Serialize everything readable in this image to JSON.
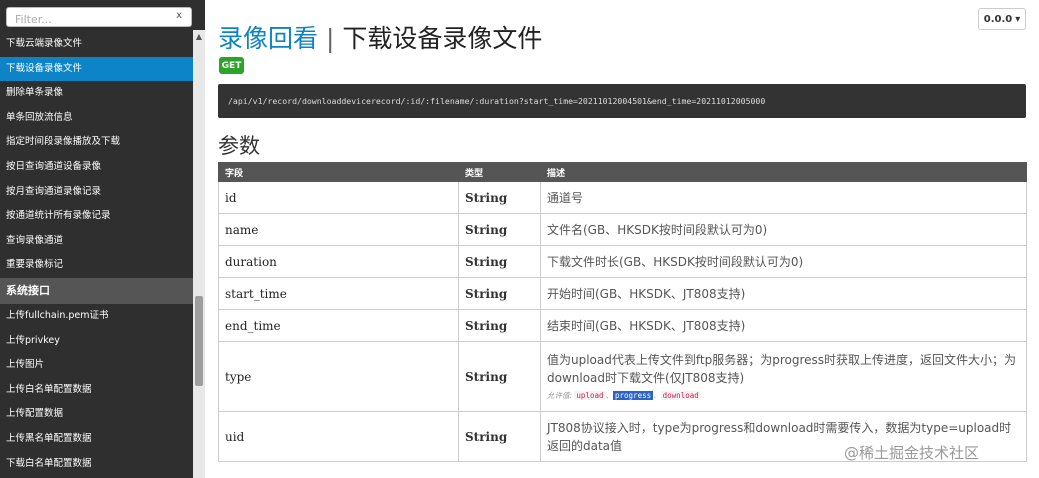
{
  "sidebar": {
    "filter_placeholder": "Filter...",
    "filter_clear": "x",
    "items": [
      {
        "label": "下载云端录像文件",
        "active": false
      },
      {
        "label": "下载设备录像文件",
        "active": true
      },
      {
        "label": "删除单条录像",
        "active": false
      },
      {
        "label": "单条回放流信息",
        "active": false
      },
      {
        "label": "指定时间段录像播放及下载",
        "active": false
      },
      {
        "label": "按日查询通道设备录像",
        "active": false
      },
      {
        "label": "按月查询通道录像记录",
        "active": false
      },
      {
        "label": "按通道统计所有录像记录",
        "active": false
      },
      {
        "label": "查询录像通道",
        "active": false
      },
      {
        "label": "重要录像标记",
        "active": false
      }
    ],
    "section_label": "系统接口",
    "items2": [
      {
        "label": "上传fullchain.pem证书"
      },
      {
        "label": "上传privkey"
      },
      {
        "label": "上传图片"
      },
      {
        "label": "上传白名单配置数据"
      },
      {
        "label": "上传配置数据"
      },
      {
        "label": "上传黑名单配置数据"
      },
      {
        "label": "下载白名单配置数据"
      }
    ]
  },
  "header": {
    "title_link": "录像回看",
    "title_sep": "|",
    "title_rest": "下载设备录像文件",
    "version": "0.0.0",
    "method": "GET",
    "url": "/api/v1/record/downloaddevicerecord/:id/:filename/:duration?start_time=20211012004501&end_time=20211012005000"
  },
  "params": {
    "heading": "参数",
    "columns": [
      "字段",
      "类型",
      "描述"
    ],
    "rows": [
      {
        "field": "id",
        "type": "String",
        "desc": "通道号"
      },
      {
        "field": "name",
        "type": "String",
        "desc": "文件名(GB、HKSDK按时间段默认可为0)"
      },
      {
        "field": "duration",
        "type": "String",
        "desc": "下载文件时长(GB、HKSDK按时间段默认可为0)"
      },
      {
        "field": "start_time",
        "type": "String",
        "desc": "开始时间(GB、HKSDK、JT808支持)"
      },
      {
        "field": "end_time",
        "type": "String",
        "desc": "结束时间(GB、HKSDK、JT808支持)"
      },
      {
        "field": "type",
        "type": "String",
        "desc": "值为upload代表上传文件到ftp服务器；为progress时获取上传进度，返回文件大小；为download时下载文件(仅JT808支持)",
        "allowed_label": "允许值:",
        "allowed": [
          "upload",
          "progress",
          "download"
        ],
        "allowed_selected": "progress"
      },
      {
        "field": "uid",
        "type": "String",
        "desc": "JT808协议接入时，type为progress和download时需要传入，数据为type=upload时返回的data值"
      }
    ]
  },
  "watermark": "@稀土掘金技术社区",
  "colors": {
    "accent": "#0d84c7",
    "method_get": "#2aa52a",
    "sidebar_bg": "#2f2f2f",
    "table_header": "#555555"
  }
}
